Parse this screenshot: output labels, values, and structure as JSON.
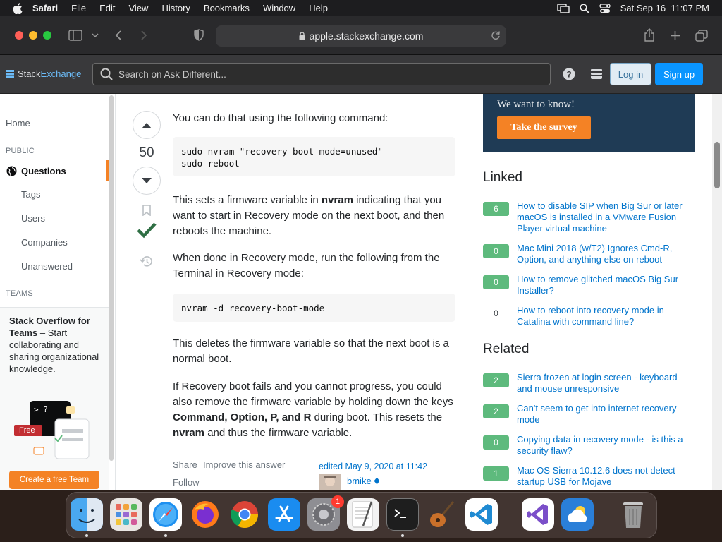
{
  "menubar": {
    "app": "Safari",
    "items": [
      "File",
      "Edit",
      "View",
      "History",
      "Bookmarks",
      "Window",
      "Help"
    ],
    "datetime": "Sat Sep 16  11:07 PM"
  },
  "browser": {
    "url": "apple.stackexchange.com"
  },
  "header": {
    "logo_stack": "Stack",
    "logo_exchange": "Exchange",
    "search_placeholder": "Search on Ask Different...",
    "login": "Log in",
    "signup": "Sign up"
  },
  "sidebar": {
    "home": "Home",
    "public_label": "PUBLIC",
    "questions": "Questions",
    "items": [
      "Tags",
      "Users",
      "Companies",
      "Unanswered"
    ],
    "teams_label": "TEAMS",
    "teams_title": "Stack Overflow for Teams",
    "teams_desc": " – Start collaborating and sharing organizational knowledge.",
    "free_badge": "Free",
    "create_team": "Create a free Team"
  },
  "answer": {
    "votes": "50",
    "p1": "You can do that using the following command:",
    "code1": "sudo nvram \"recovery-boot-mode=unused\"\nsudo reboot",
    "p2_a": "This sets a firmware variable in ",
    "p2_b": "nvram",
    "p2_c": " indicating that you want to start in Recovery mode on the next boot, and then reboots the machine.",
    "p3": "When done in Recovery mode, run the following from the Terminal in Recovery mode:",
    "code2": "nvram -d recovery-boot-mode",
    "p4": "This deletes the firmware variable so that the next boot is a normal boot.",
    "p5_a": "If Recovery boot fails and you cannot progress, you could also remove the firmware variable by holding down the keys ",
    "p5_b": "Command, Option, P, and R",
    "p5_c": " during boot. This resets the ",
    "p5_d": "nvram",
    "p5_e": " and thus the firmware variable.",
    "share": "Share",
    "improve": "Improve this answer",
    "follow": "Follow",
    "edited": "edited May 9, 2020 at 11:42",
    "editor": "bmike"
  },
  "survey": {
    "text": "We want to know!",
    "button": "Take the survey"
  },
  "linked": {
    "heading": "Linked",
    "items": [
      {
        "score": "6",
        "title": "How to disable SIP when Big Sur or later macOS is installed in a VMware Fusion Player virtual machine"
      },
      {
        "score": "0",
        "title": "Mac Mini 2018 (w/T2) Ignores Cmd-R, Option, and anything else on reboot"
      },
      {
        "score": "0",
        "title": "How to remove glitched macOS Big Sur Installer?"
      },
      {
        "score": "0",
        "title": "How to reboot into recovery mode in Catalina with command line?"
      }
    ]
  },
  "related": {
    "heading": "Related",
    "items": [
      {
        "score": "2",
        "title": "Sierra frozen at login screen - keyboard and mouse unresponsive"
      },
      {
        "score": "2",
        "title": "Can't seem to get into internet recovery mode"
      },
      {
        "score": "0",
        "title": "Copying data in recovery mode - is this a security flaw?"
      },
      {
        "score": "1",
        "title": "Mac OS Sierra 10.12.6 does not detect startup USB for Mojave"
      }
    ]
  },
  "dock": {
    "settings_badge": "1"
  }
}
